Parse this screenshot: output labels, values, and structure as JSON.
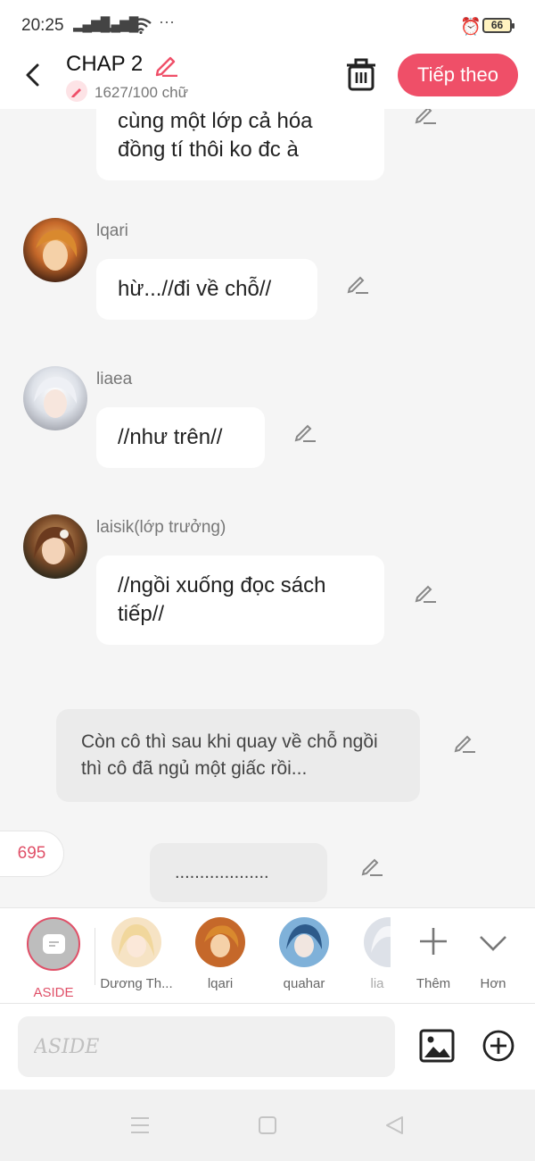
{
  "status_bar": {
    "time": "20:25",
    "signal1": "▂▄▆█",
    "signal2": "▂▄▆█",
    "extra": "···",
    "battery": "66"
  },
  "header": {
    "title": "CHAP 2",
    "word_count": "1627/100 chữ",
    "next_label": "Tiếp theo"
  },
  "messages": [
    {
      "type": "bubble",
      "text": "cùng một lớp cả hóa đồng tí thôi ko đc à"
    },
    {
      "type": "bubble",
      "name": "lqari",
      "text": "hừ...//đi về chỗ//"
    },
    {
      "type": "bubble",
      "name": "liaea",
      "text": "//như trên//"
    },
    {
      "type": "bubble",
      "name": "laisik(lớp trưởng)",
      "text": "//ngồi xuống đọc sách tiếp//"
    },
    {
      "type": "narration",
      "text": "Còn cô thì sau khi quay về chỗ ngồi thì cô đã ngủ một giấc rồi..."
    },
    {
      "type": "narration",
      "text": "..................."
    }
  ],
  "badge_count": "695",
  "characters": [
    {
      "label": "ASIDE"
    },
    {
      "label": "Dương Th..."
    },
    {
      "label": "lqari"
    },
    {
      "label": "quahar"
    },
    {
      "label": "lia"
    },
    {
      "label": "Thêm"
    },
    {
      "label": "Hơn"
    }
  ],
  "input": {
    "placeholder": "ASIDE"
  },
  "colors": {
    "accent": "#ef4f68",
    "background": "#f5f5f5",
    "bubble": "#ffffff",
    "narration": "#ebebeb"
  }
}
